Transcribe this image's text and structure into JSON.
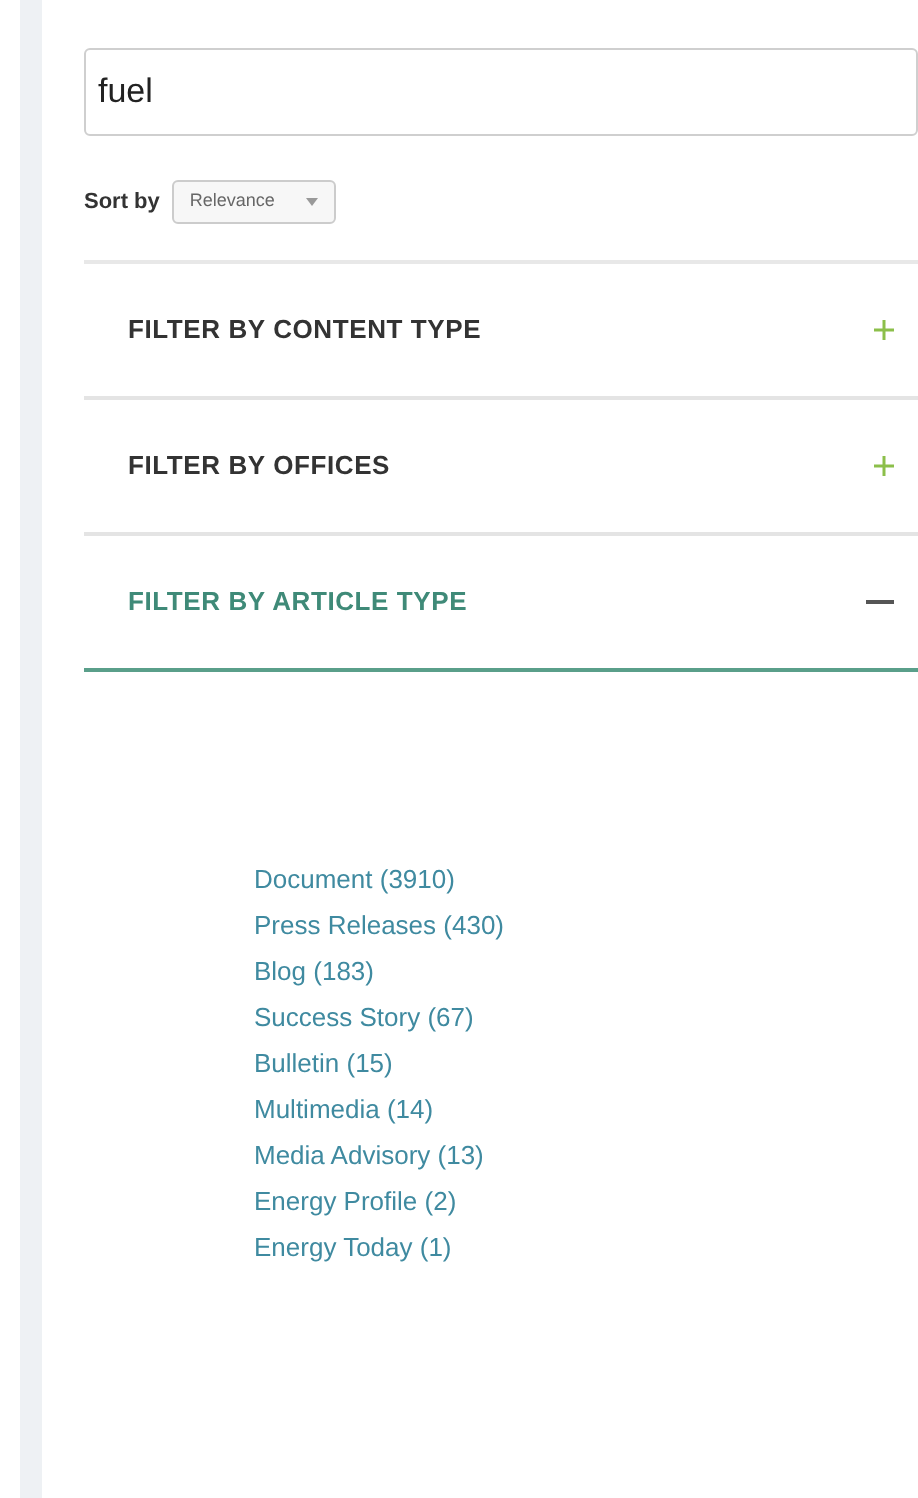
{
  "search": {
    "value": "fuel"
  },
  "sort": {
    "label": "Sort by",
    "value": "Relevance"
  },
  "filters": [
    {
      "title": "FILTER BY CONTENT TYPE",
      "expanded": false
    },
    {
      "title": "FILTER BY OFFICES",
      "expanded": false
    },
    {
      "title": "FILTER BY ARTICLE TYPE",
      "expanded": true,
      "items": [
        "Document (3910)",
        "Press Releases (430)",
        "Blog (183)",
        "Success Story (67)",
        "Bulletin (15)",
        "Multimedia (14)",
        "Media Advisory (13)",
        "Energy Profile (2)",
        "Energy Today (1)"
      ]
    }
  ]
}
